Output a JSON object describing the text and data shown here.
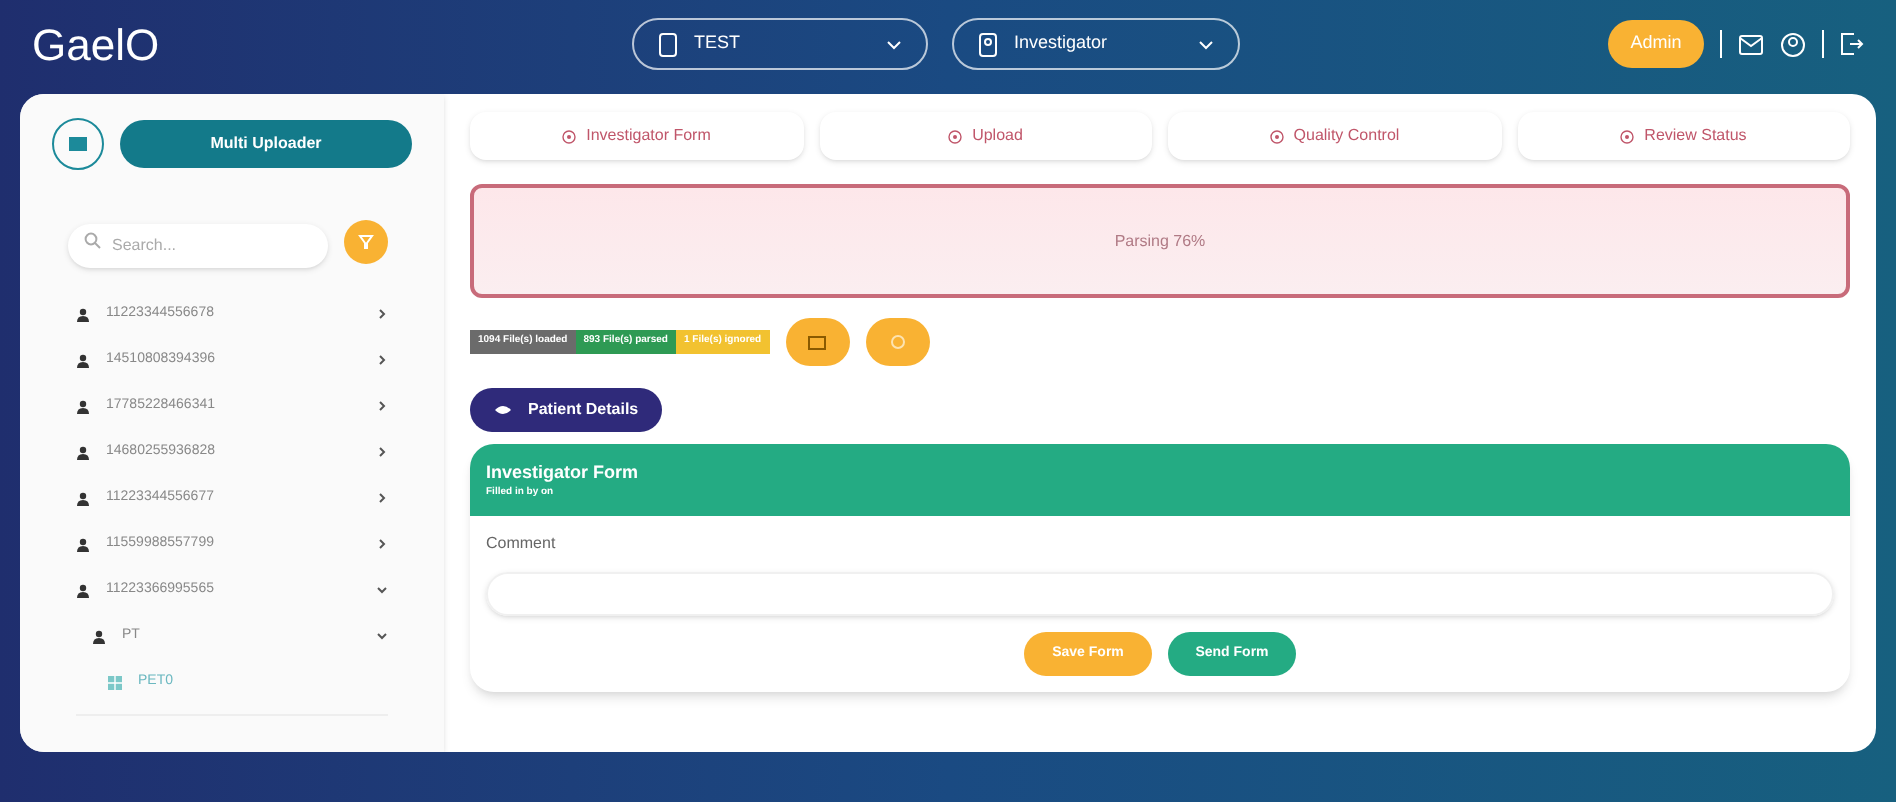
{
  "header": {
    "logo": "GaelO",
    "study_select": "TEST",
    "role_select": "Investigator",
    "admin_button": "Admin"
  },
  "sidebar": {
    "mode_button": "Multi Uploader",
    "search": {
      "placeholder": "Search..."
    },
    "tree": [
      {
        "label": "11223344556678",
        "kind": "patient",
        "expanded": false
      },
      {
        "label": "14510808394396",
        "kind": "patient",
        "expanded": false
      },
      {
        "label": "17785228466341",
        "kind": "patient",
        "expanded": false
      },
      {
        "label": "14680255936828",
        "kind": "patient",
        "expanded": false
      },
      {
        "label": "11223344556677",
        "kind": "patient",
        "expanded": false
      },
      {
        "label": "11559988557799",
        "kind": "patient",
        "expanded": false
      },
      {
        "label": "11223366995565",
        "kind": "patient",
        "expanded": true,
        "children": [
          {
            "label": "PT",
            "kind": "patient",
            "expanded": true,
            "children": [
              {
                "label": "PET0",
                "kind": "visit"
              }
            ]
          }
        ]
      }
    ]
  },
  "steps": [
    {
      "label": "Investigator Form"
    },
    {
      "label": "Upload"
    },
    {
      "label": "Quality Control"
    },
    {
      "label": "Review Status"
    }
  ],
  "dropzone": {
    "status": "Parsing 76%"
  },
  "file_badges": [
    {
      "label": "1094 File(s) loaded",
      "color": "#6b6b6b"
    },
    {
      "label": "893 File(s) parsed",
      "color": "#2e9a54"
    },
    {
      "label": "1 File(s) ignored",
      "color": "#f2c230"
    }
  ],
  "patient_details_button": "Patient Details",
  "form": {
    "title": "Investigator Form",
    "subtitle": "Filled in by on",
    "comment_label": "Comment",
    "buttons": [
      {
        "label": "Save Form",
        "kind": "save"
      },
      {
        "label": "Send Form",
        "kind": "send"
      }
    ]
  }
}
